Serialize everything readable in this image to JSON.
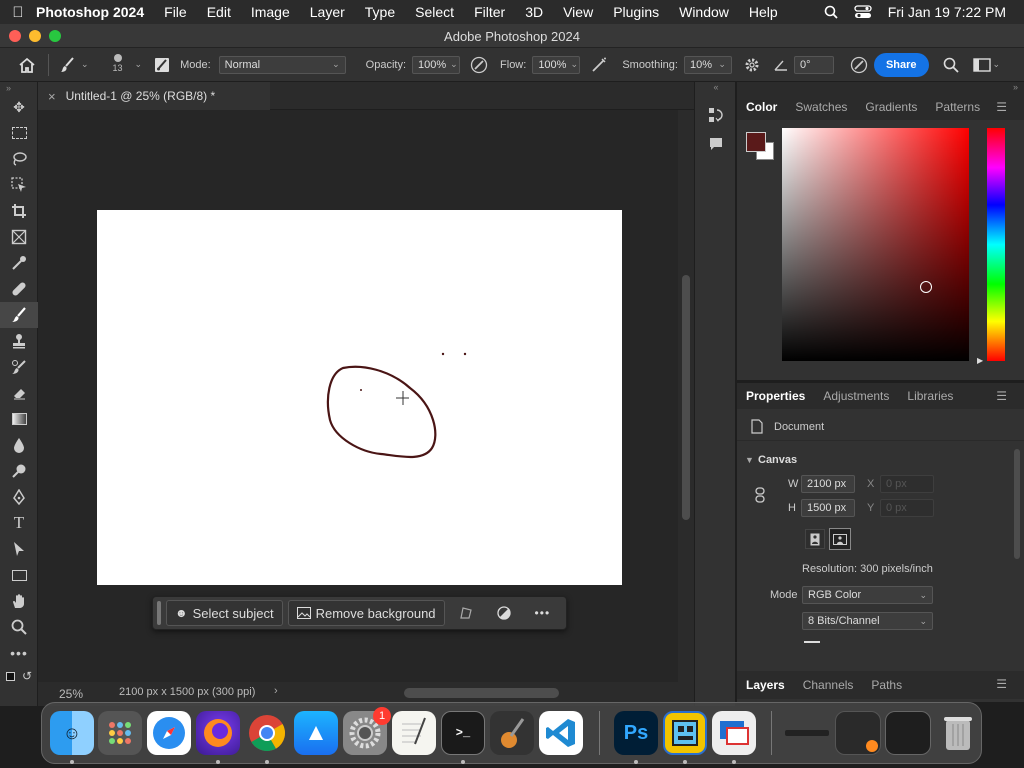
{
  "menubar": {
    "app_name": "Photoshop 2024",
    "items": [
      "File",
      "Edit",
      "Image",
      "Layer",
      "Type",
      "Select",
      "Filter",
      "3D",
      "View",
      "Plugins",
      "Window",
      "Help"
    ],
    "datetime": "Fri Jan 19  7:22 PM"
  },
  "window": {
    "title": "Adobe Photoshop 2024"
  },
  "options": {
    "brush_size": "13",
    "mode_label": "Mode:",
    "mode_value": "Normal",
    "opacity_label": "Opacity:",
    "opacity_value": "100%",
    "flow_label": "Flow:",
    "flow_value": "100%",
    "smoothing_label": "Smoothing:",
    "smoothing_value": "10%",
    "angle_value": "0°",
    "share_label": "Share"
  },
  "document": {
    "tab_title": "Untitled-1 @ 25% (RGB/8) *",
    "zoom": "25%",
    "info": "2100 px x 1500 px (300 ppi)"
  },
  "context_bar": {
    "select_subject": "Select subject",
    "remove_background": "Remove background"
  },
  "color_panel": {
    "tabs": [
      "Color",
      "Swatches",
      "Gradients",
      "Patterns"
    ],
    "foreground": "#5a1a1a",
    "background": "#ffffff",
    "hue_color": "#ff0000"
  },
  "properties_panel": {
    "tabs": [
      "Properties",
      "Adjustments",
      "Libraries"
    ],
    "document_label": "Document",
    "canvas_label": "Canvas",
    "w_label": "W",
    "w_value": "2100 px",
    "h_label": "H",
    "h_value": "1500 px",
    "x_label": "X",
    "x_placeholder": "0 px",
    "y_label": "Y",
    "y_placeholder": "0 px",
    "resolution": "Resolution: 300 pixels/inch",
    "mode_label": "Mode",
    "mode_value": "RGB Color",
    "bits_value": "8 Bits/Channel"
  },
  "layers_panel": {
    "tabs": [
      "Layers",
      "Channels",
      "Paths"
    ]
  },
  "dock": {
    "badge": "1",
    "ps_label": "Ps"
  }
}
